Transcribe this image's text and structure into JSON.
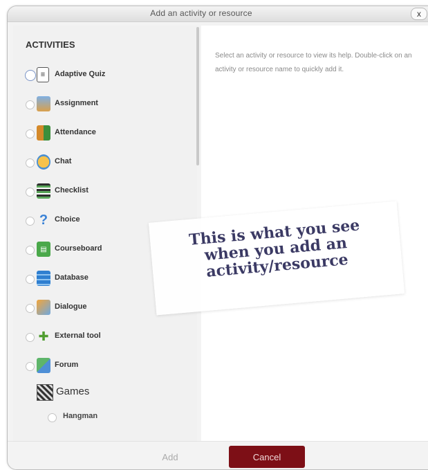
{
  "dialog": {
    "title": "Add an activity or resource",
    "close_label": "x"
  },
  "activities": {
    "heading": "ACTIVITIES",
    "items": [
      {
        "label": "Adaptive Quiz",
        "icon": "adaptive-quiz-icon"
      },
      {
        "label": "Assignment",
        "icon": "assignment-icon"
      },
      {
        "label": "Attendance",
        "icon": "attendance-icon"
      },
      {
        "label": "Chat",
        "icon": "chat-icon"
      },
      {
        "label": "Checklist",
        "icon": "checklist-icon"
      },
      {
        "label": "Choice",
        "icon": "choice-icon"
      },
      {
        "label": "Courseboard",
        "icon": "courseboard-icon"
      },
      {
        "label": "Database",
        "icon": "database-icon"
      },
      {
        "label": "Dialogue",
        "icon": "dialogue-icon"
      },
      {
        "label": "External tool",
        "icon": "external-tool-icon"
      },
      {
        "label": "Forum",
        "icon": "forum-icon"
      }
    ],
    "games_group": {
      "label": "Games",
      "icon": "games-icon",
      "items": [
        {
          "label": "Hangman"
        }
      ]
    }
  },
  "help": {
    "text": "Select an activity or resource to view its help. Double-click on an activity or resource name to quickly add it."
  },
  "footer": {
    "add_label": "Add",
    "cancel_label": "Cancel"
  },
  "overlay": {
    "text": "This is what you see\nwhen you add an\nactivity/resource"
  },
  "colors": {
    "cancel_button": "#7d0f16",
    "overlay_text": "#3b3a64"
  }
}
